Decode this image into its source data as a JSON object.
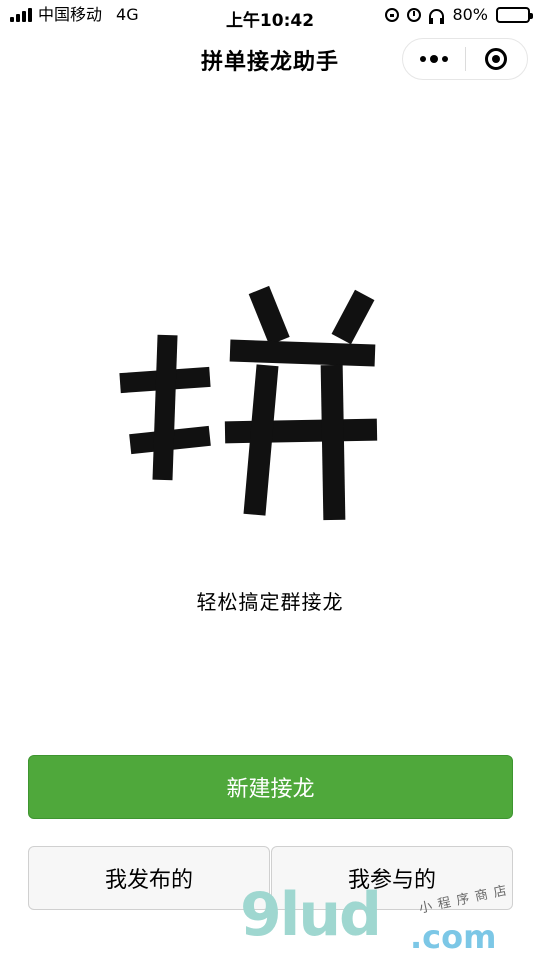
{
  "status_bar": {
    "carrier": "中国移动",
    "network": "4G",
    "time": "上午10:42",
    "battery_percent": "80%",
    "battery_level": 0.8,
    "icons": [
      "signal-icon",
      "rotation-lock-icon",
      "alarm-icon",
      "headphones-icon",
      "battery-icon"
    ]
  },
  "navbar": {
    "title": "拼单接龙助手",
    "menu_icon": "more-dots-icon",
    "close_icon": "target-icon"
  },
  "main": {
    "logo_text": "拼",
    "tagline": "轻松搞定群接龙"
  },
  "actions": {
    "primary_label": "新建接龙",
    "my_published_label": "我发布的",
    "my_joined_label": "我参与的"
  },
  "watermark": {
    "brand": "9lud",
    "suffix": ".com",
    "subtitle": "小程序商店"
  },
  "colors": {
    "primary": "#4fa83b",
    "secondary_bg": "#f7f7f7",
    "text": "#000000"
  }
}
